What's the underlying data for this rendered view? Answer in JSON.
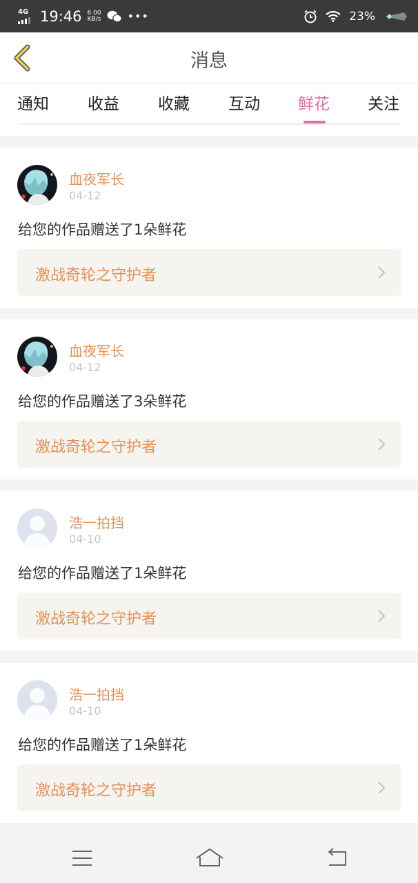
{
  "status_bar": {
    "network": "4G",
    "time": "19:46",
    "speed_value": "6.00",
    "speed_unit": "KB/s",
    "battery": "23%"
  },
  "header": {
    "title": "消息"
  },
  "tabs": [
    {
      "label": "通知"
    },
    {
      "label": "收益"
    },
    {
      "label": "收藏"
    },
    {
      "label": "互动"
    },
    {
      "label": "鲜花",
      "active": true
    },
    {
      "label": "关注"
    }
  ],
  "messages": [
    {
      "user": "血夜军长",
      "date": "04-12",
      "text": "给您的作品赠送了1朵鲜花",
      "work": "激战奇轮之守护者"
    },
    {
      "user": "血夜军长",
      "date": "04-12",
      "text": "给您的作品赠送了3朵鲜花",
      "work": "激战奇轮之守护者"
    },
    {
      "user": "浩一拍挡",
      "date": "04-10",
      "text": "给您的作品赠送了1朵鲜花",
      "work": "激战奇轮之守护者"
    },
    {
      "user": "浩一拍挡",
      "date": "04-10",
      "text": "给您的作品赠送了1朵鲜花",
      "work": "激战奇轮之守护者"
    }
  ],
  "colors": {
    "accent": "#e26fa7",
    "name_orange": "#e3915b",
    "work_card_bg": "#f5f4ee"
  },
  "icons": {
    "back": "back-chevron-icon",
    "avatar_custom": "anime-avatar",
    "avatar_default": "default-person-avatar",
    "chevron": "chevron-right-icon",
    "nav_menu": "menu-icon",
    "nav_home": "home-icon",
    "nav_back": "return-icon"
  }
}
